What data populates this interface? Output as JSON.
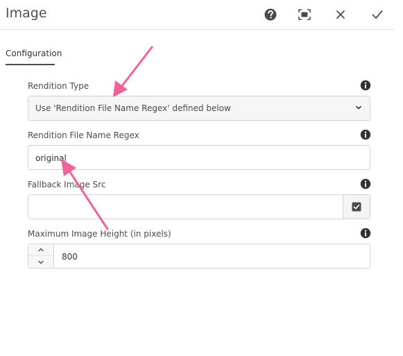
{
  "dialog": {
    "title": "Image",
    "actions": {
      "help_icon": "help-circle-icon",
      "fullscreen_icon": "fullscreen-icon",
      "close_icon": "close-icon",
      "done_icon": "checkmark-icon"
    }
  },
  "tabs": [
    {
      "label": "Configuration",
      "selected": true
    }
  ],
  "form": {
    "rendition_type": {
      "label": "Rendition Type",
      "value": "Use 'Rendition File Name Regex' defined below"
    },
    "rendition_regex": {
      "label": "Rendition File Name Regex",
      "value": "original"
    },
    "fallback_src": {
      "label": "Fallback Image Src",
      "value": ""
    },
    "max_height": {
      "label": "Maximum Image Height (in pixels)",
      "value": "800"
    }
  },
  "colors": {
    "annotation_arrow": "#f0629a",
    "icon": "#4b4b4b"
  }
}
